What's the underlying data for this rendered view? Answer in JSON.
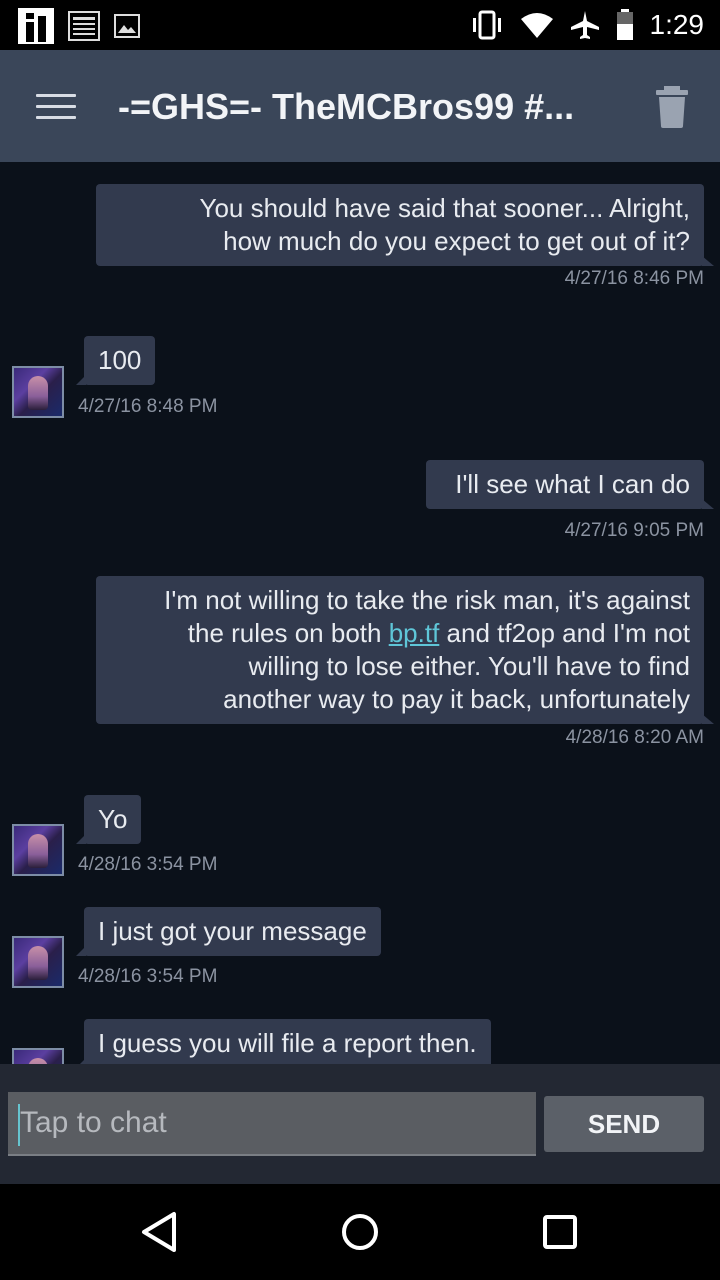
{
  "status_bar": {
    "time": "1:29",
    "left_icons": [
      "app-notification-icon",
      "news-icon",
      "image-icon"
    ],
    "right_icons": [
      "vibrate-icon",
      "wifi-icon",
      "airplane-icon",
      "battery-icon"
    ]
  },
  "header": {
    "title": "-=GHS=- TheMCBros99 #...",
    "menu_icon": "menu-icon",
    "delete_icon": "trash-icon"
  },
  "messages": [
    {
      "direction": "out",
      "lines": [
        "You should have said that sooner... Alright,",
        "how much do you expect to get out of it?"
      ],
      "timestamp": "4/27/16 8:46 PM"
    },
    {
      "direction": "in",
      "text": "100",
      "timestamp": "4/27/16 8:48 PM"
    },
    {
      "direction": "out",
      "text": "I'll see what I can do",
      "timestamp": "4/27/16 9:05 PM"
    },
    {
      "direction": "out",
      "line1": "I'm not willing to take the risk man, it's against",
      "line2_before": "the rules on both ",
      "link": "bp.tf",
      "line2_after": " and tf2op and I'm not",
      "line3": "willing to lose either. You'll have to find",
      "line4": "another way to pay it back, unfortunately",
      "timestamp": "4/28/16 8:20 AM"
    },
    {
      "direction": "in",
      "text": "Yo",
      "timestamp": "4/28/16 3:54 PM"
    },
    {
      "direction": "in",
      "text": "I just got your message",
      "timestamp": "4/28/16 3:54 PM"
    },
    {
      "direction": "in",
      "text": "I guess you will file a report then."
    }
  ],
  "input": {
    "placeholder": "Tap to chat",
    "value": "",
    "send_label": "SEND"
  },
  "nav": {
    "icons": [
      "back-icon",
      "home-icon",
      "recents-icon"
    ]
  }
}
